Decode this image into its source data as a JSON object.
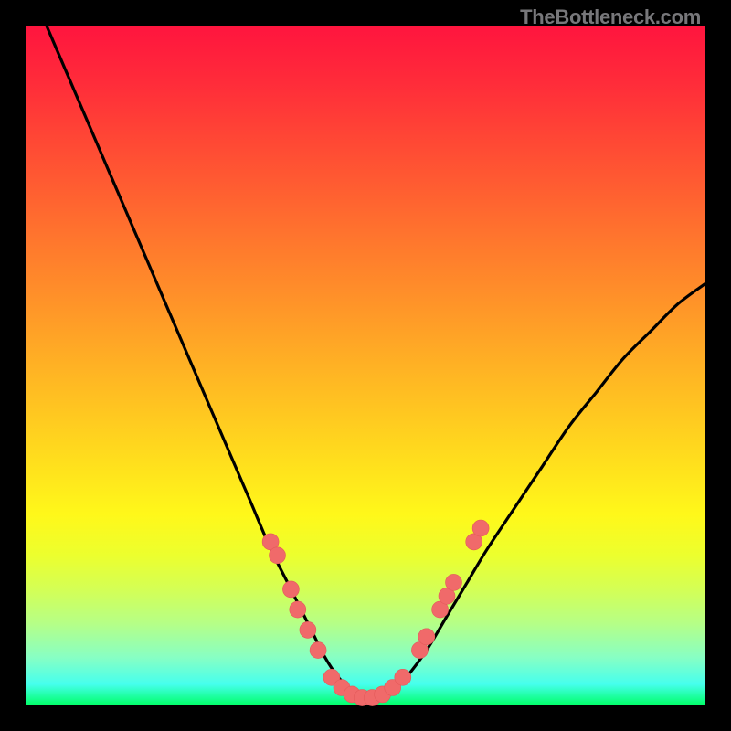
{
  "attribution": "TheBottleneck.com",
  "colors": {
    "frame": "#000000",
    "gradient_top": "#ff153e",
    "gradient_bottom": "#02ff6c",
    "curve": "#000000",
    "dots": "#f06a6a"
  },
  "chart_data": {
    "type": "line",
    "title": "",
    "xlabel": "",
    "ylabel": "",
    "xlim": [
      0,
      100
    ],
    "ylim": [
      0,
      100
    ],
    "grid": false,
    "series": [
      {
        "name": "bottleneck-curve",
        "x": [
          3,
          6,
          9,
          12,
          15,
          18,
          21,
          24,
          27,
          30,
          33,
          36,
          39,
          42,
          44,
          46,
          48,
          50,
          52,
          54,
          56,
          59,
          62,
          65,
          68,
          72,
          76,
          80,
          84,
          88,
          92,
          96,
          100
        ],
        "y": [
          100,
          93,
          86,
          79,
          72,
          65,
          58,
          51,
          44,
          37,
          30,
          23,
          17,
          11,
          7,
          4,
          2,
          1,
          1,
          2,
          4,
          8,
          13,
          18,
          23,
          29,
          35,
          41,
          46,
          51,
          55,
          59,
          62
        ]
      }
    ],
    "highlight_points": {
      "name": "highlighted-markers",
      "points": [
        {
          "x": 36,
          "y": 24
        },
        {
          "x": 37,
          "y": 22
        },
        {
          "x": 39,
          "y": 17
        },
        {
          "x": 40,
          "y": 14
        },
        {
          "x": 41.5,
          "y": 11
        },
        {
          "x": 43,
          "y": 8
        },
        {
          "x": 45,
          "y": 4
        },
        {
          "x": 46.5,
          "y": 2.5
        },
        {
          "x": 48,
          "y": 1.5
        },
        {
          "x": 49.5,
          "y": 1
        },
        {
          "x": 51,
          "y": 1
        },
        {
          "x": 52.5,
          "y": 1.5
        },
        {
          "x": 54,
          "y": 2.5
        },
        {
          "x": 55.5,
          "y": 4
        },
        {
          "x": 58,
          "y": 8
        },
        {
          "x": 59,
          "y": 10
        },
        {
          "x": 61,
          "y": 14
        },
        {
          "x": 62,
          "y": 16
        },
        {
          "x": 63,
          "y": 18
        },
        {
          "x": 66,
          "y": 24
        },
        {
          "x": 67,
          "y": 26
        }
      ]
    }
  }
}
